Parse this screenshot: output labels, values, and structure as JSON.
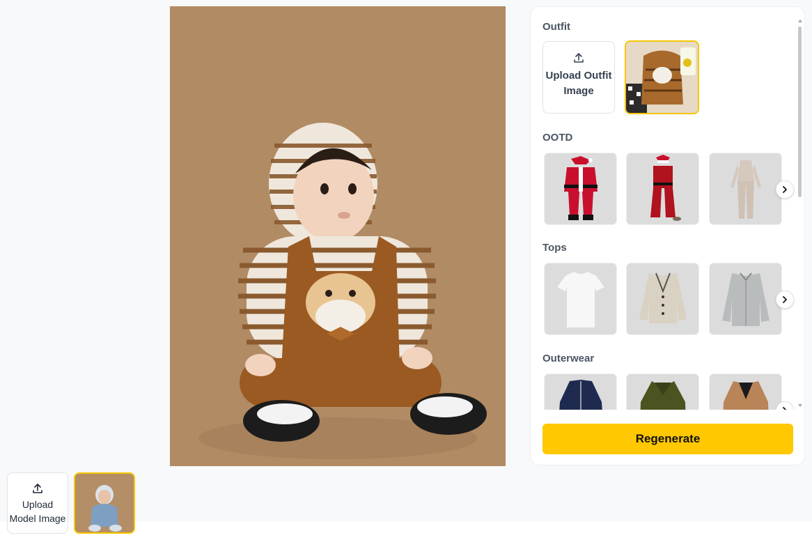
{
  "outfit": {
    "title": "Outfit",
    "upload_label": "Upload Outfit Image",
    "selected_icon": "outfit-selected-thumbnail"
  },
  "sections": [
    {
      "title": "OOTD",
      "items": [
        "santa-suit",
        "red-jumpsuit-santa-hat",
        "beige-bodysuit"
      ]
    },
    {
      "title": "Tops",
      "items": [
        "white-tshirt",
        "beige-cardigan",
        "grey-shirt"
      ]
    },
    {
      "title": "Outerwear",
      "items": [
        "navy-jacket",
        "olive-jacket",
        "tan-blazer"
      ]
    }
  ],
  "actions": {
    "regenerate_label": "Regenerate"
  },
  "model": {
    "upload_label": "Upload Model Image"
  },
  "colors": {
    "accent": "#ffc800",
    "selected_border": "#f7c600",
    "panel_bg": "#ffffff"
  },
  "icons": {
    "upload": "upload-icon",
    "next": "chevron-right-icon"
  }
}
